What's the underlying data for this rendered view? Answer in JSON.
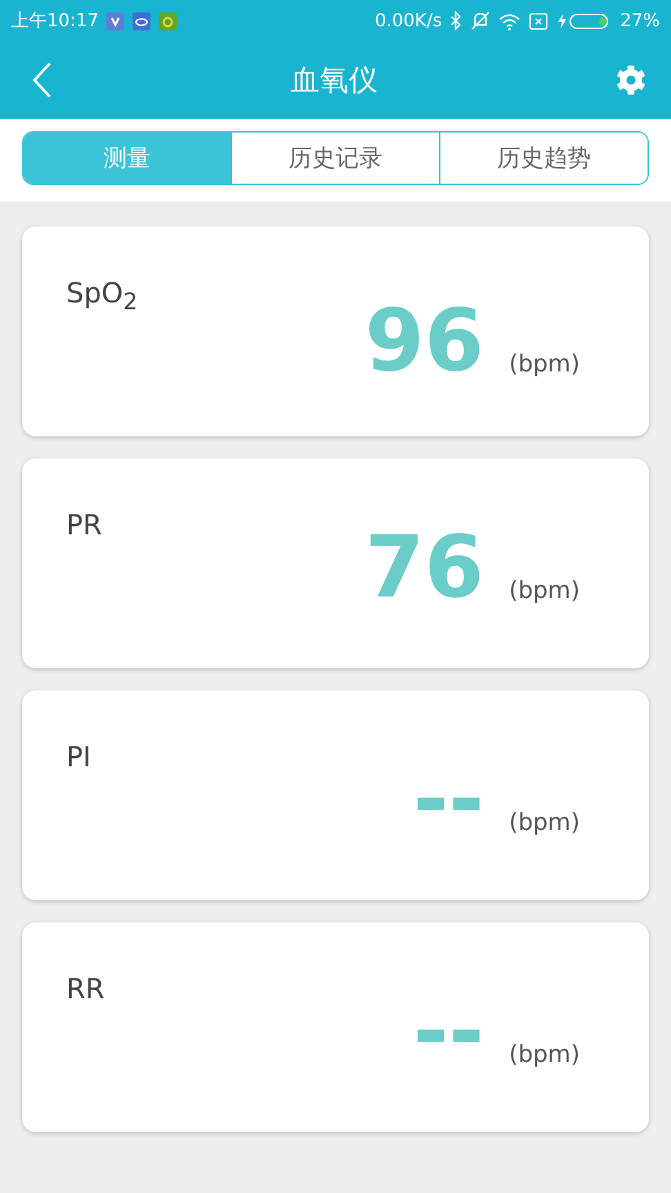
{
  "status_bar": {
    "time": "上午10:17",
    "speed": "0.00K/s",
    "battery": "27%"
  },
  "header": {
    "title": "血氧仪"
  },
  "tabs": [
    {
      "label": "测量",
      "selected": true
    },
    {
      "label": "历史记录",
      "selected": false
    },
    {
      "label": "历史趋势",
      "selected": false
    }
  ],
  "readings": [
    {
      "name": "SpO$_{2}$",
      "value": "96",
      "unit": "(bpm)"
    },
    {
      "name": "PR",
      "value": "76",
      "unit": "(bpm)"
    },
    {
      "name": "PI",
      "value": "--",
      "unit": "(bpm)"
    },
    {
      "name": "RR",
      "value": "--",
      "unit": "(bpm)"
    }
  ]
}
